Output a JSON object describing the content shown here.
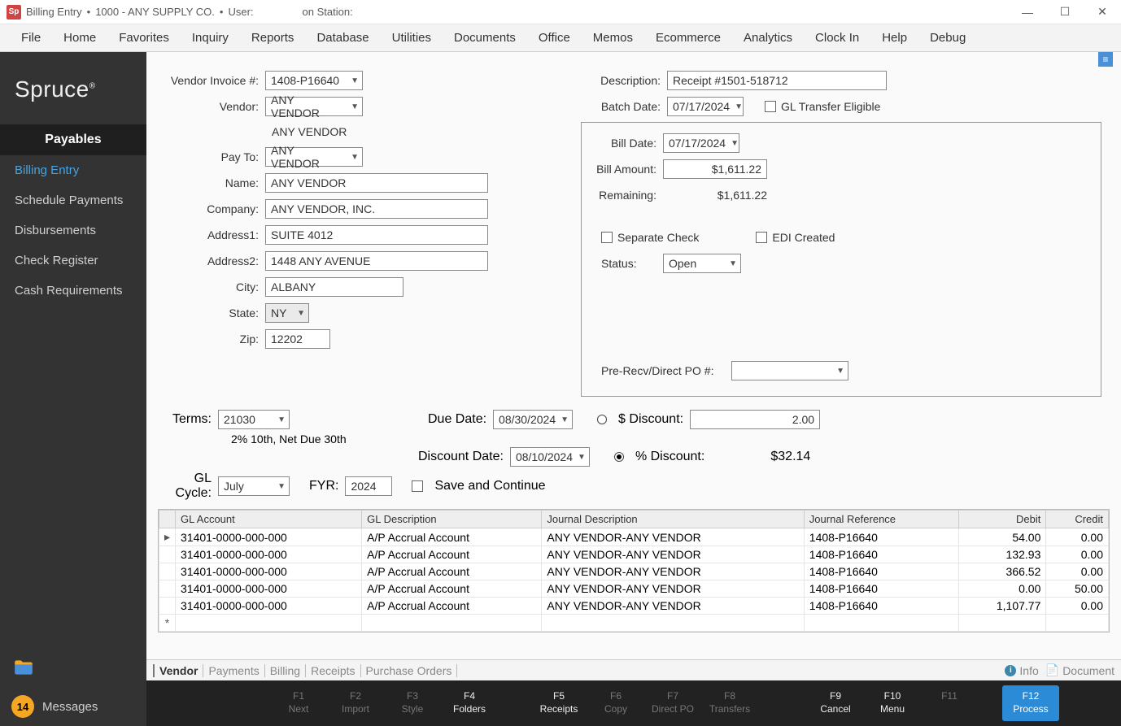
{
  "titlebar": {
    "app": "Billing Entry",
    "sep1": "•",
    "company": "1000 - ANY SUPPLY CO.",
    "sep2": "•",
    "userlabel": "User:",
    "stationlabel": "on Station:",
    "logo": "Sp"
  },
  "menubar": [
    "File",
    "Home",
    "Favorites",
    "Inquiry",
    "Reports",
    "Database",
    "Utilities",
    "Documents",
    "Office",
    "Memos",
    "Ecommerce",
    "Analytics",
    "Clock In",
    "Help",
    "Debug"
  ],
  "sidebar": {
    "brand": "Spruce",
    "section": "Payables",
    "items": [
      "Billing Entry",
      "Schedule Payments",
      "Disbursements",
      "Check Register",
      "Cash Requirements"
    ],
    "activeIndex": 0,
    "messagesCount": "14",
    "messagesLabel": "Messages"
  },
  "form": {
    "labels": {
      "vendorInvoice": "Vendor Invoice #:",
      "vendor": "Vendor:",
      "payTo": "Pay To:",
      "name": "Name:",
      "company": "Company:",
      "address1": "Address1:",
      "address2": "Address2:",
      "city": "City:",
      "state": "State:",
      "zip": "Zip:",
      "description": "Description:",
      "batchDate": "Batch Date:",
      "glTransfer": "GL Transfer Eligible",
      "billDate": "Bill Date:",
      "billAmount": "Bill Amount:",
      "remaining": "Remaining:",
      "separateCheck": "Separate Check",
      "ediCreated": "EDI Created",
      "status": "Status:",
      "preRecv": "Pre-Recv/Direct PO #:",
      "terms": "Terms:",
      "dueDate": "Due Date:",
      "dollarDiscount": "$ Discount:",
      "discountDate": "Discount Date:",
      "pctDiscount": "% Discount:",
      "glCycle": "GL Cycle:",
      "fyr": "FYR:",
      "saveContinue": "Save and Continue"
    },
    "values": {
      "vendorInvoice": "1408-P16640",
      "vendor": "ANY VENDOR",
      "vendorName": "ANY VENDOR",
      "payTo": "ANY VENDOR",
      "name": "ANY VENDOR",
      "company": "ANY VENDOR, INC.",
      "address1": "SUITE 4012",
      "address2": "1448 ANY AVENUE",
      "city": "ALBANY",
      "state": "NY",
      "zip": "12202",
      "description": "Receipt #1501-518712",
      "batchDate": "07/17/2024",
      "billDate": "07/17/2024",
      "billAmount": "$1,611.22",
      "remaining": "$1,611.22",
      "status": "Open",
      "preRecv": "",
      "terms": "21030",
      "termsDesc": "2% 10th, Net Due 30th",
      "dueDate": "08/30/2024",
      "dollarDiscount": "2.00",
      "discountDate": "08/10/2024",
      "pctDiscount": "$32.14",
      "glCycle": "July",
      "fyr": "2024"
    }
  },
  "grid": {
    "headers": [
      "GL Account",
      "GL Description",
      "Journal Description",
      "Journal Reference",
      "Debit",
      "Credit"
    ],
    "rows": [
      {
        "gl": "31401-0000-000-000",
        "desc": "A/P Accrual Account",
        "jd": "ANY VENDOR-ANY VENDOR",
        "jr": "1408-P16640",
        "debit": "54.00",
        "credit": "0.00"
      },
      {
        "gl": "31401-0000-000-000",
        "desc": "A/P Accrual Account",
        "jd": "ANY VENDOR-ANY VENDOR",
        "jr": "1408-P16640",
        "debit": "132.93",
        "credit": "0.00"
      },
      {
        "gl": "31401-0000-000-000",
        "desc": "A/P Accrual Account",
        "jd": "ANY VENDOR-ANY VENDOR",
        "jr": "1408-P16640",
        "debit": "366.52",
        "credit": "0.00"
      },
      {
        "gl": "31401-0000-000-000",
        "desc": "A/P Accrual Account",
        "jd": "ANY VENDOR-ANY VENDOR",
        "jr": "1408-P16640",
        "debit": "0.00",
        "credit": "50.00"
      },
      {
        "gl": "31401-0000-000-000",
        "desc": "A/P Accrual Account",
        "jd": "ANY VENDOR-ANY VENDOR",
        "jr": "1408-P16640",
        "debit": "1,107.77",
        "credit": "0.00"
      }
    ]
  },
  "tabs": {
    "items": [
      "Vendor",
      "Payments",
      "Billing",
      "Receipts",
      "Purchase Orders"
    ],
    "activeIndex": 0,
    "info": "Info",
    "document": "Document"
  },
  "fkeys": [
    {
      "key": "F1",
      "label": "Next",
      "enabled": false
    },
    {
      "key": "F2",
      "label": "Import",
      "enabled": false
    },
    {
      "key": "F3",
      "label": "Style",
      "enabled": false
    },
    {
      "key": "F4",
      "label": "Folders",
      "enabled": true
    },
    {
      "key": "F5",
      "label": "Receipts",
      "enabled": true
    },
    {
      "key": "F6",
      "label": "Copy",
      "enabled": false
    },
    {
      "key": "F7",
      "label": "Direct PO",
      "enabled": false
    },
    {
      "key": "F8",
      "label": "Transfers",
      "enabled": false
    },
    {
      "key": "F9",
      "label": "Cancel",
      "enabled": true
    },
    {
      "key": "F10",
      "label": "Menu",
      "enabled": true
    },
    {
      "key": "F11",
      "label": "",
      "enabled": false
    },
    {
      "key": "F12",
      "label": "Process",
      "enabled": true,
      "primary": true
    }
  ]
}
